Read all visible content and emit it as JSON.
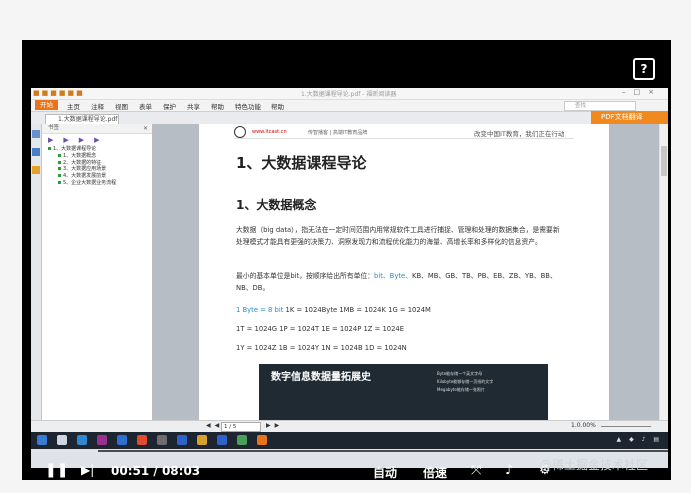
{
  "video": {
    "time_current": "00:51",
    "time_total": "08:03",
    "progress": 0.105,
    "controls": [
      "自动",
      "倍速"
    ],
    "help_icon_label": "?"
  },
  "app": {
    "title": "1.大数据课程导论.pdf - 福昕阅读器",
    "menus": [
      "开始",
      "主页",
      "注释",
      "视图",
      "表单",
      "保护",
      "共享",
      "帮助",
      "特色功能",
      "帮助"
    ],
    "search_placeholder": "查找",
    "pdf_translate": "PDF文档翻译",
    "tab_name": "1.大数据课程导论.pdf"
  },
  "bookmarks": {
    "header": "书签",
    "items": [
      {
        "label": "1、大数据课程导论",
        "level": 1
      },
      {
        "label": "1、大数据概念",
        "level": 2
      },
      {
        "label": "2、大数据的特征",
        "level": 2
      },
      {
        "label": "3、大数据应用场景",
        "level": 2
      },
      {
        "label": "4、大数据发展前景",
        "level": 2
      },
      {
        "label": "5、企业大数据业务流程",
        "level": 2
      }
    ]
  },
  "document": {
    "header_url": "www.itcast.cn",
    "header_brand": "传智播客 | 高端IT教育品牌",
    "header_slogan": "改变中国IT教育，我们正在行动",
    "h1": "1、大数据课程导论",
    "h2": "1、大数据概念",
    "para1": "大数据（big data），指无法在一定时间范围内用常规软件工具进行捕捉、管理和处理的数据集合，是需要新处理模式才能具有更强的决策力、洞察发现力和流程优化能力的海量、高增长率和多样化的信息资产。",
    "para2_prefix": "最小的基本单位是bit，按顺序给出所有单位：",
    "para2_hl": "bit、Byte、",
    "para2_rest": "KB、MB、GB、TB、PB、EB、ZB、YB、BB、NB、DB。",
    "line1_hl": "1 Byte = 8 bit",
    "line1_rest": " 1K = 1024Byte 1MB = 1024K 1G = 1024M",
    "line2": "1T = 1024G 1P = 1024T 1E = 1024P 1Z = 1024E",
    "line3": "1Y = 1024Z 1B = 1024Y 1N = 1024B 1D = 1024N",
    "figure_title": "数字信息数据量拓展史",
    "figure_note1": "Byte能存储一个英文字母",
    "figure_note2": "Kilobyte能够存储一页纸的文字",
    "figure_note3": "Megabyte能存储一张照片"
  },
  "status": {
    "page_field": "1 / 5",
    "zoom": "1.0.00%"
  },
  "watermark": "@稀土掘金技术社区",
  "colors": {
    "accent": "#e8731a",
    "link": "#2a8fbd",
    "taskbar": "#1d2530"
  }
}
